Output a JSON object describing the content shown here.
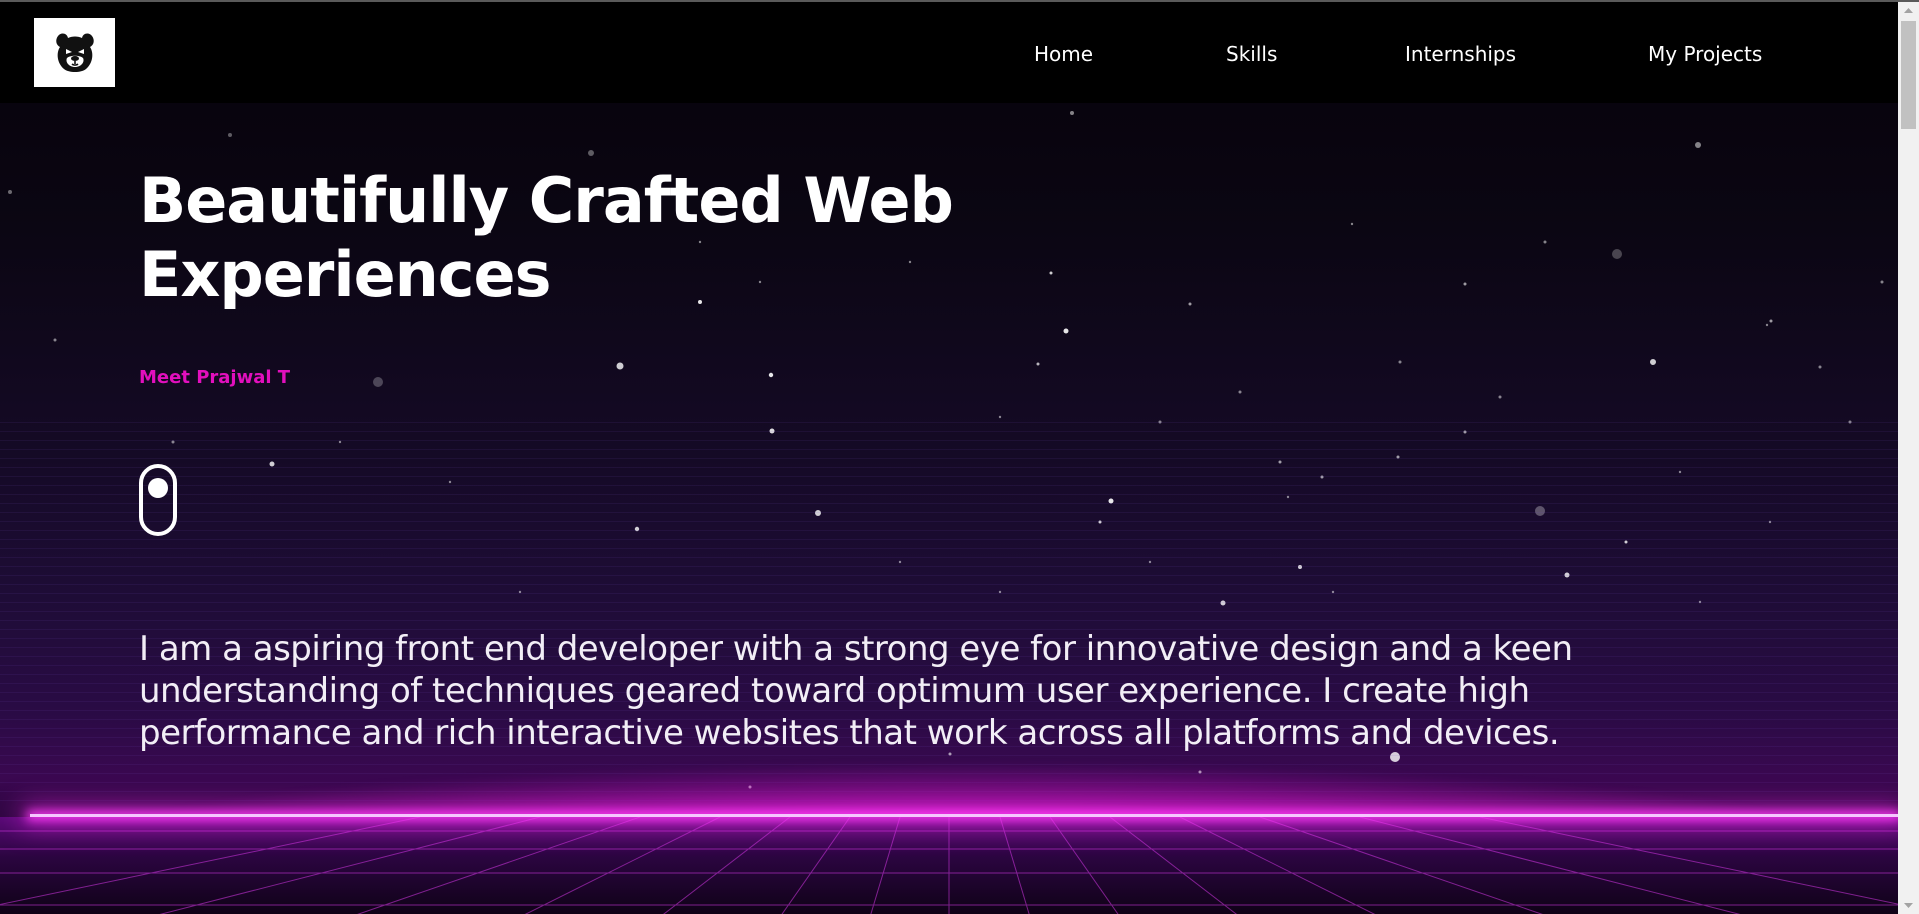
{
  "header": {
    "logo_icon": "bear-face-icon",
    "nav": [
      {
        "label": "Home"
      },
      {
        "label": "Skills"
      },
      {
        "label": "Internships"
      },
      {
        "label": "My Projects"
      }
    ]
  },
  "hero": {
    "title": "Beautifully Crafted Web Experiences",
    "subtitle": "Meet Prajwal T",
    "scroll_icon": "mouse-scroll-icon",
    "bio": "I am a aspiring front end developer with a strong eye for innovative design and a keen understanding of techniques geared toward optimum user experience. I create high performance and rich interactive websites that work across all platforms and devices."
  },
  "colors": {
    "accent": "#e20fbd",
    "background": "#000000",
    "glow": "#ff3df7"
  }
}
